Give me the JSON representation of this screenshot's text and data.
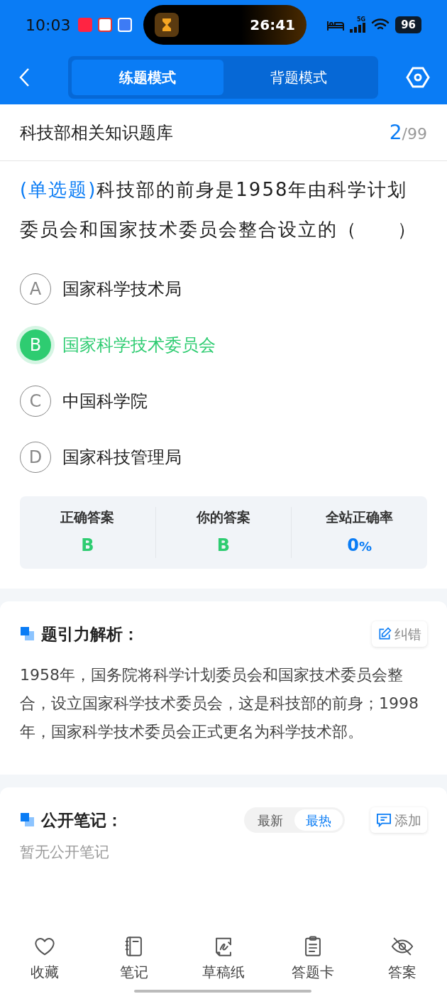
{
  "status_bar": {
    "time": "10:03",
    "timer": "26:41",
    "network": "5G",
    "battery": "96"
  },
  "header": {
    "tabs": [
      {
        "label": "练题模式",
        "selected": true
      },
      {
        "label": "背题模式",
        "selected": false
      }
    ]
  },
  "bank": {
    "title": "科技部相关知识题库",
    "current": "2",
    "total": "/99"
  },
  "question": {
    "type": "(单选题)",
    "text": "科技部的前身是1958年由科学计划委员会和国家技术委员会整合设立的（　　）"
  },
  "options": [
    {
      "letter": "A",
      "text": "国家科学技术局",
      "selected": false
    },
    {
      "letter": "B",
      "text": "国家科学技术委员会",
      "selected": true
    },
    {
      "letter": "C",
      "text": "中国科学院",
      "selected": false
    },
    {
      "letter": "D",
      "text": "国家科技管理局",
      "selected": false
    }
  ],
  "stats": [
    {
      "label": "正确答案",
      "value": "B",
      "color": "#2ecc71"
    },
    {
      "label": "你的答案",
      "value": "B",
      "color": "#2ecc71"
    },
    {
      "label": "全站正确率",
      "value": "0",
      "unit": "%",
      "color": "#0a7cf5"
    }
  ],
  "analysis": {
    "title": "题引力解析：",
    "action": "纠错",
    "text": "1958年，国务院将科学计划委员会和国家技术委员会整合，设立国家科学技术委员会，这是科技部的前身；1998年，国家科学技术委员会正式更名为科学技术部。"
  },
  "notes": {
    "title": "公开笔记：",
    "sort": [
      {
        "label": "最新",
        "selected": false
      },
      {
        "label": "最热",
        "selected": true
      }
    ],
    "action": "添加",
    "empty": "暂无公开笔记"
  },
  "bottom_nav": [
    {
      "kind": "heart",
      "label": "收藏"
    },
    {
      "kind": "notebook",
      "label": "笔记"
    },
    {
      "kind": "draft",
      "label": "草稿纸"
    },
    {
      "kind": "clipboard",
      "label": "答题卡"
    },
    {
      "kind": "eye",
      "label": "答案"
    }
  ]
}
